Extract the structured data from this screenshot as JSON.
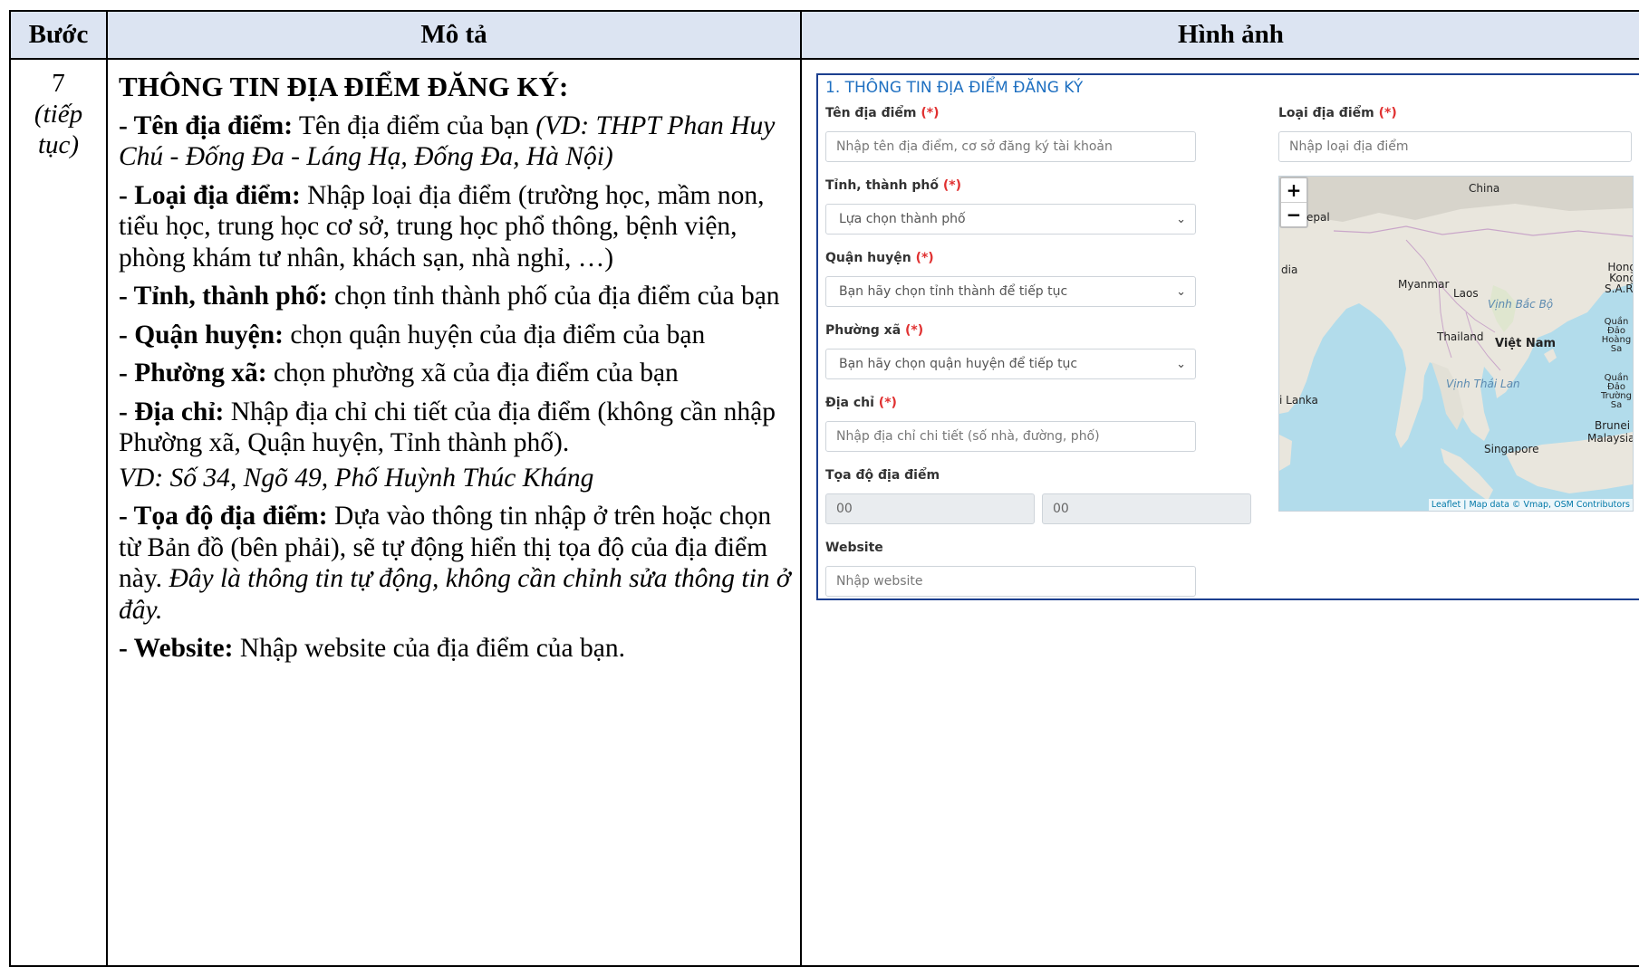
{
  "table": {
    "headers": [
      "Bước",
      "Mô tả",
      "Hình ảnh"
    ],
    "step_number": "7",
    "step_note": "(tiếp tục)"
  },
  "description": {
    "heading": "THÔNG TIN ĐỊA ĐIỂM ĐĂNG KÝ:",
    "items": [
      {
        "label": "- Tên địa điểm:",
        "text": " Tên địa điểm của bạn ",
        "italic": "(VD: THPT Phan Huy Chú - Đống Đa - Láng Hạ, Đống Đa, Hà Nội)"
      },
      {
        "label": "- Loại địa điểm:",
        "text": " Nhập loại địa điểm (trường học, mầm non, tiểu học, trung học cơ sở, trung học phổ thông, bệnh viện, phòng khám tư nhân, khách sạn, nhà nghỉ, …)"
      },
      {
        "label": "- Tỉnh, thành phố:",
        "text": " chọn tỉnh thành phố của địa điểm của bạn"
      },
      {
        "label": "- Quận huyện:",
        "text": " chọn quận huyện của địa điểm của bạn"
      },
      {
        "label": "- Phường xã:",
        "text": " chọn phường xã của địa điểm của bạn"
      },
      {
        "label": "- Địa chỉ:",
        "text": " Nhập địa chỉ chi tiết của địa điểm (không cần nhập Phường xã, Quận huyện, Tỉnh thành phố)."
      },
      {
        "italic_line": "VD: Số 34, Ngõ 49, Phố Huỳnh Thúc Kháng"
      },
      {
        "label": "- Tọa độ địa điểm:",
        "text": " Dựa vào thông tin nhập ở trên hoặc chọn từ Bản đồ (bên phải), sẽ tự động hiển thị tọa độ của địa điểm này. ",
        "italic": "Đây là thông tin tự động, không cần chỉnh sửa thông tin ở đây."
      },
      {
        "label": "- Website:",
        "text": " Nhập website của địa điểm của bạn."
      }
    ]
  },
  "form": {
    "section_title": "1. THÔNG TIN ĐỊA ĐIỂM ĐĂNG KÝ",
    "required_mark": "(*)",
    "name_label": "Tên địa điểm",
    "name_placeholder": "Nhập tên địa điểm, cơ sở đăng ký tài khoản",
    "type_label": "Loại địa điểm",
    "type_placeholder": "Nhập loại địa điểm",
    "province_label": "Tỉnh, thành phố",
    "province_value": "Lựa chọn thành phố",
    "district_label": "Quận huyện",
    "district_value": "Bạn hãy chọn tỉnh thành để tiếp tục",
    "ward_label": "Phường xã",
    "ward_value": "Bạn hãy chọn quận huyện để tiếp tục",
    "address_label": "Địa chỉ",
    "address_placeholder": "Nhập địa chỉ chi tiết (số nhà, đường, phố)",
    "coords_label": "Tọa độ địa điểm",
    "lat_value": "00",
    "lng_value": "00",
    "website_label": "Website",
    "website_placeholder": "Nhập website"
  },
  "map": {
    "zoom_in": "+",
    "zoom_out": "−",
    "labels": {
      "china": "China",
      "nepal": "epal",
      "india": "dia",
      "myanmar": "Myanmar",
      "laos": "Laos",
      "gulf_tonkin": "Vịnh Bắc Bộ",
      "hongkong": "Hong Kong S.A.R.",
      "thailand": "Thailand",
      "vietnam": "Việt Nam",
      "paracel": "Quần Đảo Hoàng Sa",
      "spratly": "Quần Đảo Trường Sa",
      "gulf_thailand": "Vịnh Thái Lan",
      "srilanka": "i Lanka",
      "brunei": "Brunei",
      "malaysia": "Malaysia",
      "singapore": "Singapore"
    },
    "attribution": "Leaflet | Map data © Vmap, OSM Contributors"
  }
}
